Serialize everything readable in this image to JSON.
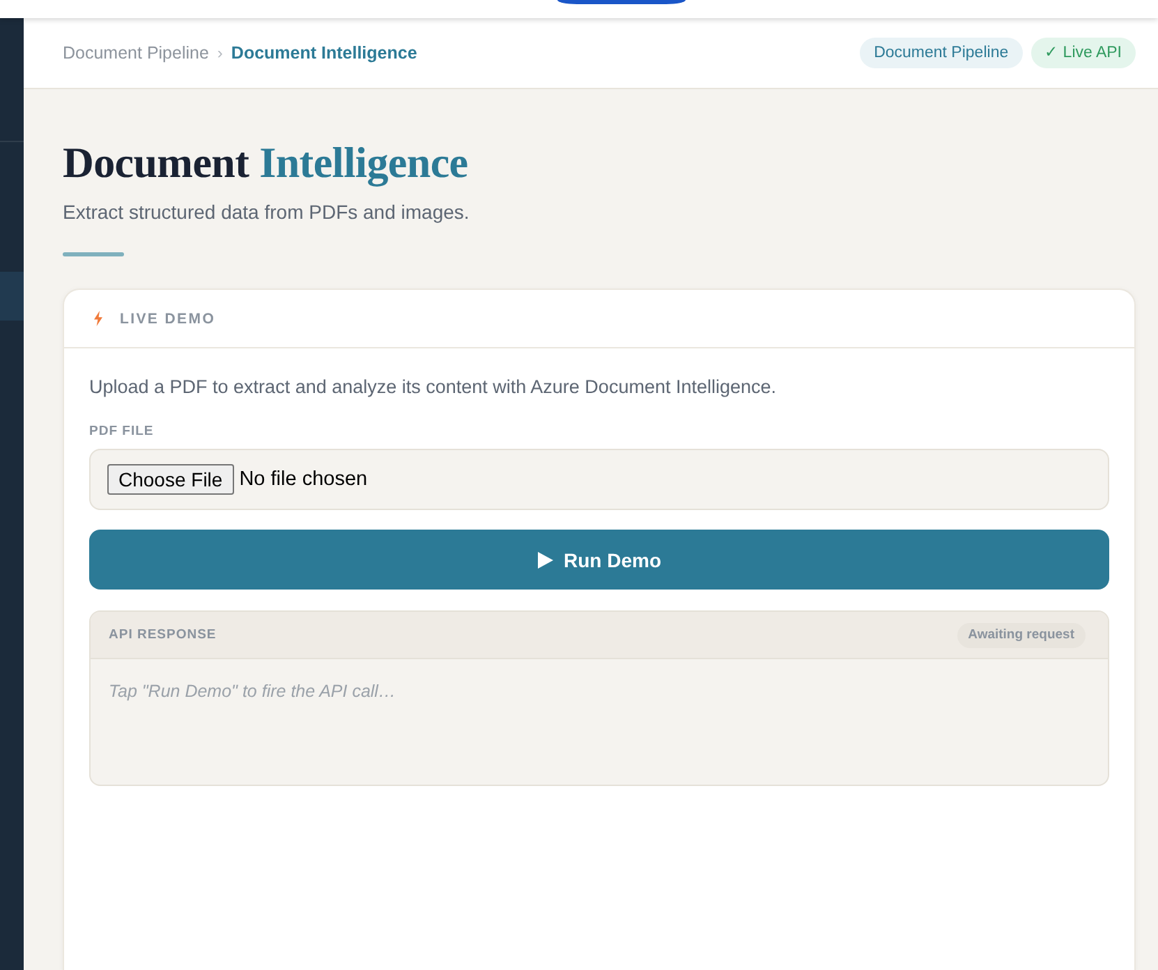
{
  "breadcrumb": [
    {
      "label": "Document Pipeline",
      "selected": false
    },
    {
      "label": "Document Intelligence",
      "selected": true
    }
  ],
  "breadcrumb_separator": "›",
  "badges": [
    {
      "kind": "section",
      "label": "Document Pipeline"
    },
    {
      "kind": "status",
      "label": "✓ Live API"
    }
  ],
  "page": {
    "title": {
      "lead": "Document",
      "accent": "Intelligence"
    },
    "subtitle": "Extract structured data from PDFs and images."
  },
  "demo_card": {
    "heading": "LIVE DEMO",
    "description": "Upload a PDF to extract and analyze its content with Azure Document Intelligence.",
    "file_field": {
      "label": "PDF FILE",
      "button": "Choose File",
      "value": "No file chosen"
    },
    "run_button": "Run Demo",
    "response": {
      "heading": "API RESPONSE",
      "status": "Awaiting request",
      "empty_message": "Tap \"Run Demo\" to fire the API call…"
    }
  }
}
